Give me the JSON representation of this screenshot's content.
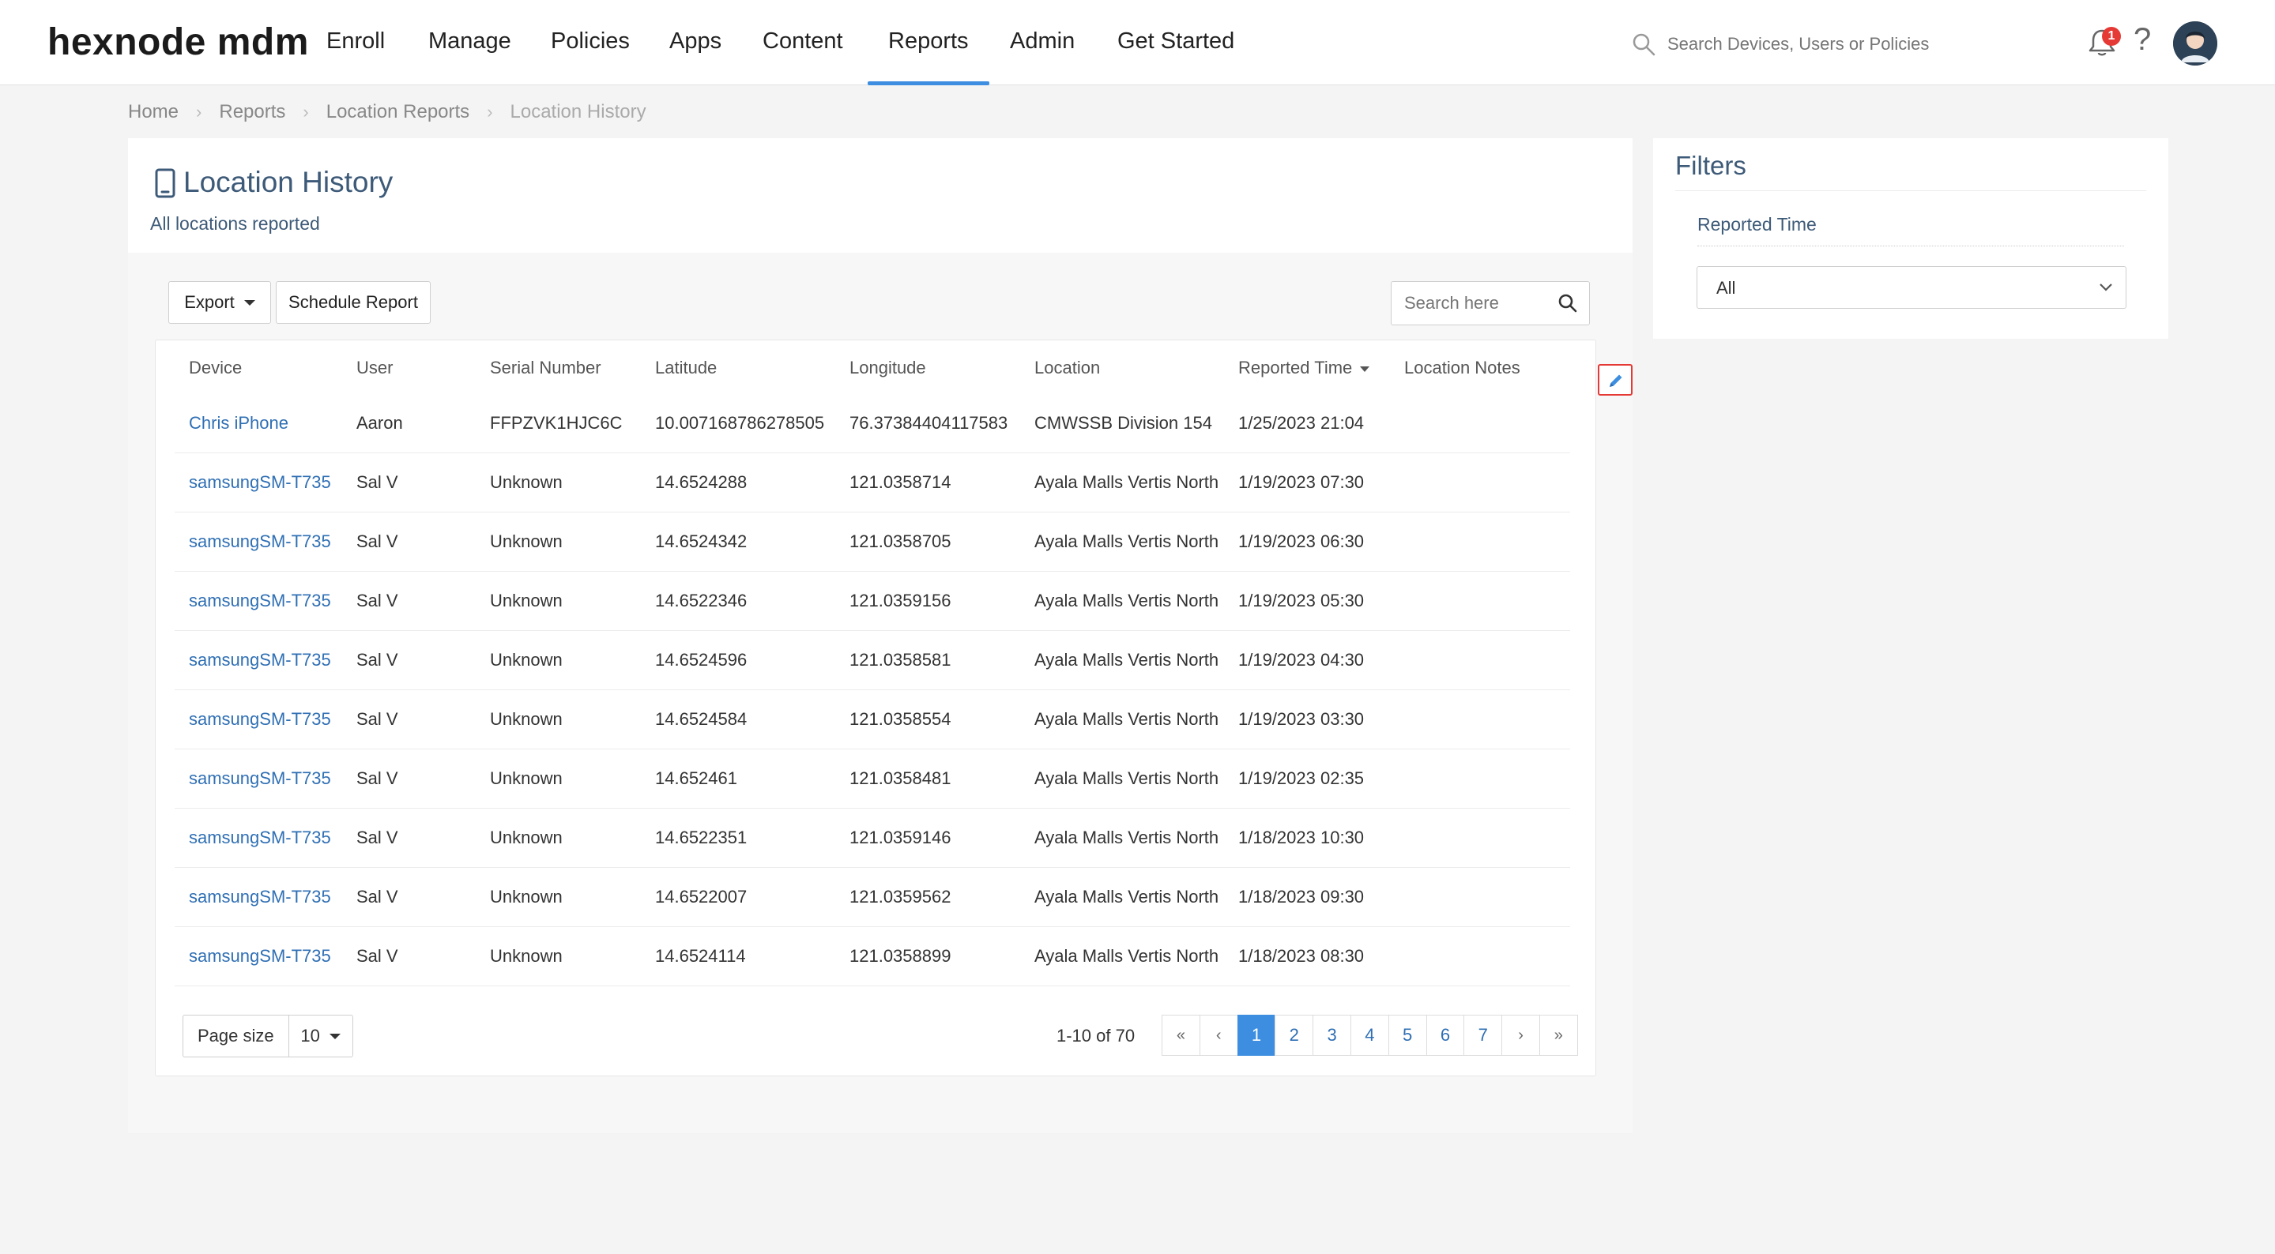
{
  "brand": {
    "logo_text": "hexnode mdm"
  },
  "nav": {
    "items": [
      {
        "label": "Enroll"
      },
      {
        "label": "Manage"
      },
      {
        "label": "Policies"
      },
      {
        "label": "Apps"
      },
      {
        "label": "Content"
      },
      {
        "label": "Reports",
        "active": true
      },
      {
        "label": "Admin"
      },
      {
        "label": "Get Started"
      }
    ],
    "search_placeholder": "Search Devices, Users or Policies",
    "notification_count": "1",
    "help_glyph": "?"
  },
  "breadcrumb": [
    "Home",
    "Reports",
    "Location Reports",
    "Location History"
  ],
  "page": {
    "title": "Location History",
    "subtitle": "All locations reported"
  },
  "toolbar": {
    "export_label": "Export",
    "schedule_label": "Schedule Report",
    "search_placeholder": "Search here"
  },
  "table": {
    "columns": [
      "Device",
      "User",
      "Serial Number",
      "Latitude",
      "Longitude",
      "Location",
      "Reported Time",
      "Location Notes"
    ],
    "sorted_column": "Reported Time",
    "rows": [
      {
        "device": "Chris iPhone",
        "user": "Aaron",
        "serial": "FFPZVK1HJC6C",
        "lat": "10.007168786278505",
        "lon": "76.37384404117583",
        "location": "CMWSSB Division 154",
        "time": "1/25/2023 21:04",
        "notes": ""
      },
      {
        "device": "samsungSM-T735",
        "user": "Sal V",
        "serial": "Unknown",
        "lat": "14.6524288",
        "lon": "121.0358714",
        "location": "Ayala Malls Vertis North",
        "time": "1/19/2023 07:30",
        "notes": ""
      },
      {
        "device": "samsungSM-T735",
        "user": "Sal V",
        "serial": "Unknown",
        "lat": "14.6524342",
        "lon": "121.0358705",
        "location": "Ayala Malls Vertis North",
        "time": "1/19/2023 06:30",
        "notes": ""
      },
      {
        "device": "samsungSM-T735",
        "user": "Sal V",
        "serial": "Unknown",
        "lat": "14.6522346",
        "lon": "121.0359156",
        "location": "Ayala Malls Vertis North",
        "time": "1/19/2023 05:30",
        "notes": ""
      },
      {
        "device": "samsungSM-T735",
        "user": "Sal V",
        "serial": "Unknown",
        "lat": "14.6524596",
        "lon": "121.0358581",
        "location": "Ayala Malls Vertis North",
        "time": "1/19/2023 04:30",
        "notes": ""
      },
      {
        "device": "samsungSM-T735",
        "user": "Sal V",
        "serial": "Unknown",
        "lat": "14.6524584",
        "lon": "121.0358554",
        "location": "Ayala Malls Vertis North",
        "time": "1/19/2023 03:30",
        "notes": ""
      },
      {
        "device": "samsungSM-T735",
        "user": "Sal V",
        "serial": "Unknown",
        "lat": "14.652461",
        "lon": "121.0358481",
        "location": "Ayala Malls Vertis North",
        "time": "1/19/2023 02:35",
        "notes": ""
      },
      {
        "device": "samsungSM-T735",
        "user": "Sal V",
        "serial": "Unknown",
        "lat": "14.6522351",
        "lon": "121.0359146",
        "location": "Ayala Malls Vertis North",
        "time": "1/18/2023 10:30",
        "notes": ""
      },
      {
        "device": "samsungSM-T735",
        "user": "Sal V",
        "serial": "Unknown",
        "lat": "14.6522007",
        "lon": "121.0359562",
        "location": "Ayala Malls Vertis North",
        "time": "1/18/2023 09:30",
        "notes": ""
      },
      {
        "device": "samsungSM-T735",
        "user": "Sal V",
        "serial": "Unknown",
        "lat": "14.6524114",
        "lon": "121.0358899",
        "location": "Ayala Malls Vertis North",
        "time": "1/18/2023 08:30",
        "notes": ""
      }
    ]
  },
  "pagination": {
    "page_size_label": "Page size",
    "page_size": "10",
    "range_text": "1-10 of 70",
    "first": "«",
    "prev": "‹",
    "pages": [
      "1",
      "2",
      "3",
      "4",
      "5",
      "6",
      "7"
    ],
    "current_page": "1",
    "next": "›",
    "last": "»"
  },
  "filters": {
    "title": "Filters",
    "reported_time_label": "Reported Time",
    "reported_time_value": "All"
  },
  "colors": {
    "accent": "#3d8ee0",
    "link": "#2f6fb4",
    "heading": "#3d5a78",
    "badge": "#e53935"
  }
}
